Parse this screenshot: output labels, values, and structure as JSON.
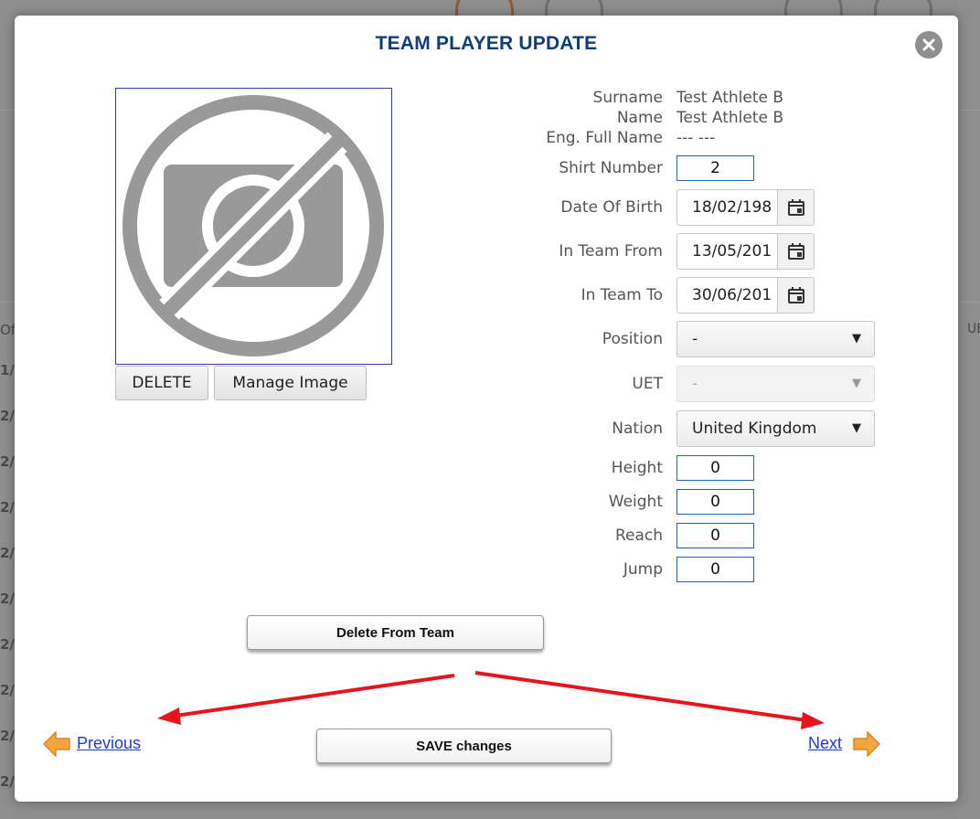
{
  "modal": {
    "title": "TEAM PLAYER UPDATE"
  },
  "photo": {
    "placeholder_icon": "no-image-icon",
    "delete_label": "DELETE",
    "manage_label": "Manage Image"
  },
  "player": {
    "surname_label": "Surname",
    "surname": "Test Athlete B",
    "name_label": "Name",
    "name": "Test Athlete B",
    "eng_full_name_label": "Eng. Full Name",
    "eng_full_name": "--- ---",
    "shirt_number_label": "Shirt Number",
    "shirt_number": "2",
    "dob_label": "Date Of Birth",
    "dob": "18/02/198",
    "in_team_from_label": "In Team From",
    "in_team_from": "13/05/201",
    "in_team_to_label": "In Team To",
    "in_team_to": "30/06/201",
    "position_label": "Position",
    "position": "-",
    "uet_label": "UET",
    "uet": "-",
    "nation_label": "Nation",
    "nation": "United Kingdom",
    "height_label": "Height",
    "height": "0",
    "weight_label": "Weight",
    "weight": "0",
    "reach_label": "Reach",
    "reach": "0",
    "jump_label": "Jump",
    "jump": "0"
  },
  "actions": {
    "delete_from_team": "Delete From Team",
    "save": "SAVE changes",
    "previous": "Previous",
    "next": "Next"
  },
  "background": {
    "left_fragments": [
      "Of",
      "1/",
      "2/",
      "2/",
      "2/",
      "2/",
      "2/",
      "2/",
      "2/",
      "2/",
      "2/"
    ],
    "right_fragment": "UE"
  },
  "colors": {
    "title": "#0f3f7a",
    "link": "#1a3fcc",
    "input_border": "#1f63b5",
    "annotation_arrow": "#e8141b",
    "nav_arrow": "#f5a540"
  }
}
